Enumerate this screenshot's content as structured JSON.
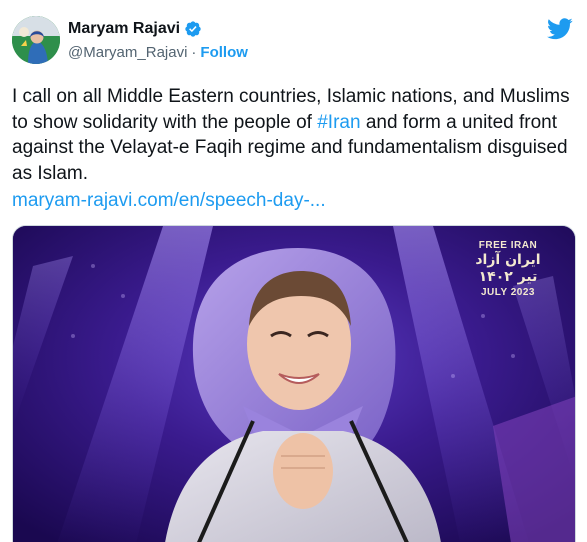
{
  "tweet": {
    "author_name": "Maryam Rajavi",
    "handle": "@Maryam_Rajavi",
    "separator": "·",
    "follow_label": "Follow",
    "text_part1": "I call on all Middle Eastern countries, Islamic nations, and Muslims to show solidarity with the people of ",
    "hashtag": "#Iran",
    "text_part2": " and form a united front against the Velayat-e Faqih regime and fundamentalism disguised as Islam.",
    "link_text": "maryam-rajavi.com/en/speech-day-..."
  },
  "media": {
    "watermark_line1": "FREE IRAN",
    "watermark_line2": "ایران آزاد",
    "watermark_line3": "تیر ۱۴۰۲",
    "watermark_line4": "JULY 2023"
  },
  "icons": {
    "verified": "verified-badge-icon",
    "twitter": "twitter-bird-icon"
  },
  "colors": {
    "accent": "#1d9bf0",
    "text": "#0f1419",
    "muted": "#536471",
    "stage_purple": "#3b1a8a"
  }
}
